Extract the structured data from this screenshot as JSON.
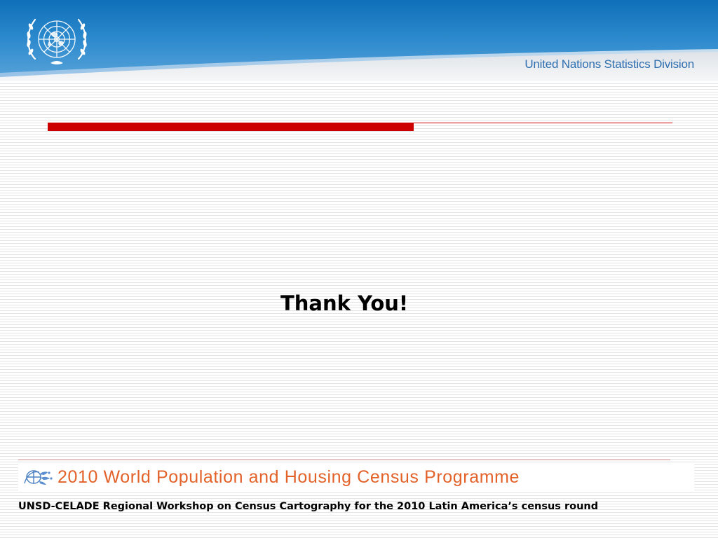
{
  "header": {
    "emblem_icon": "un-emblem-icon",
    "organization": "United Nations Statistics Division"
  },
  "slide": {
    "message": "Thank You!"
  },
  "footer": {
    "banner_icon": "census-programme-logo",
    "banner_title": "2010 World Population and Housing Census Programme",
    "workshop": "UNSD-CELADE Regional Workshop on Census Cartography for the 2010 Latin America’s census round"
  },
  "colors": {
    "header_blue": "#0f6fb8",
    "accent_red": "#cc0000",
    "banner_orange": "#e2622a",
    "org_text_blue": "#2e6fb0"
  }
}
